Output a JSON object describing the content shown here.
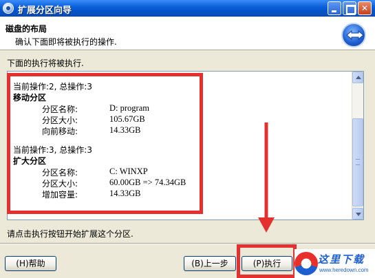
{
  "window": {
    "title": "扩展分区向导"
  },
  "header": {
    "title": "磁盘的布局",
    "subtitle": "确认下面即将被执行的操作."
  },
  "section_label": "下面的执行将被执行.",
  "operations": [
    {
      "status": "当前操作:2, 总操作:3",
      "name": "移动分区",
      "details": [
        {
          "key": "分区名称:",
          "value": "D: program"
        },
        {
          "key": "分区大小:",
          "value": "105.67GB"
        },
        {
          "key": "向前移动:",
          "value": "14.33GB"
        }
      ]
    },
    {
      "status": "当前操作:3, 总操作:3",
      "name": "扩大分区",
      "details": [
        {
          "key": "分区名称:",
          "value": "C: WINXP"
        },
        {
          "key": "分区大小:",
          "value": "60.00GB => 74.34GB"
        },
        {
          "key": "增加容量:",
          "value": "14.33GB"
        }
      ]
    }
  ],
  "hint": "请点击执行按钮开始扩展这个分区.",
  "buttons": {
    "help": "(H)帮助",
    "prev": "(B)上一步",
    "execute": "(P)执行"
  },
  "watermark": {
    "title": "这里下载",
    "url": "www.heredown.com"
  },
  "colors": {
    "annotation": "#e53030",
    "titlebar": "#0a5fd8",
    "dialog_bg": "#ece9d8"
  }
}
